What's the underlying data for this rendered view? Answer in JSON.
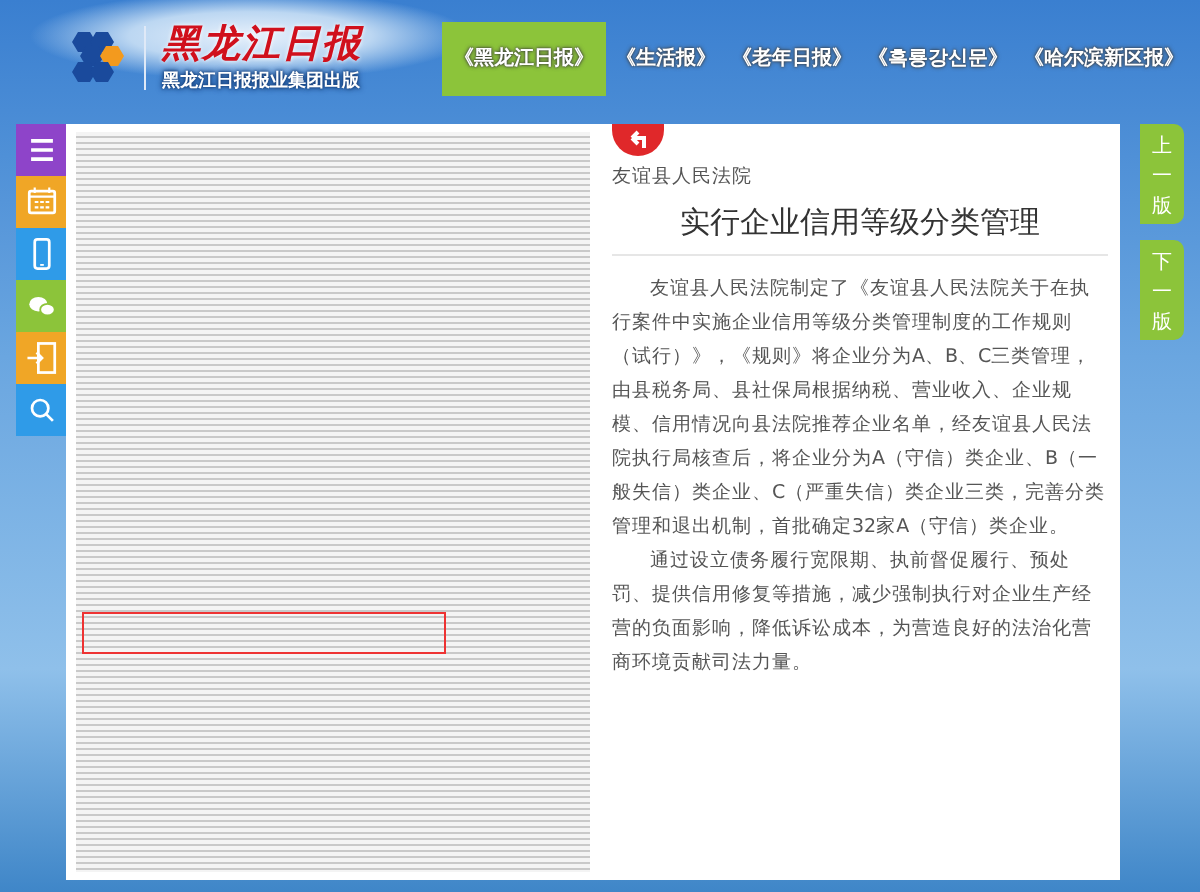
{
  "header": {
    "logo_text": "黑龙江日报",
    "subtitle": "黑龙江日报报业集团出版"
  },
  "papers": [
    {
      "label": "《黑龙江日报》",
      "selected": true
    },
    {
      "label": "《生活报》",
      "selected": false
    },
    {
      "label": "《老年日报》",
      "selected": false
    },
    {
      "label": "《흑룡강신문》",
      "selected": false
    },
    {
      "label": "《哈尔滨新区报》",
      "selected": false
    }
  ],
  "toolbar": [
    {
      "kind": "menu",
      "color": "#8e44c9"
    },
    {
      "kind": "calendar",
      "color": "#f0a626"
    },
    {
      "kind": "phone",
      "color": "#2f9be8"
    },
    {
      "kind": "chat",
      "color": "#8cc43a"
    },
    {
      "kind": "import",
      "color": "#f0a626"
    },
    {
      "kind": "search",
      "color": "#2f9be8"
    }
  ],
  "article": {
    "source": "友谊县人民法院",
    "title": "实行企业信用等级分类管理",
    "paragraphs": [
      "友谊县人民法院制定了《友谊县人民法院关于在执行案件中实施企业信用等级分类管理制度的工作规则（试行）》，《规则》将企业分为A、B、C三类管理，由县税务局、县社保局根据纳税、营业收入、企业规模、信用情况向县法院推荐企业名单，经友谊县人民法院执行局核查后，将企业分为A（守信）类企业、B（一般失信）类企业、C（严重失信）类企业三类，完善分类管理和退出机制，首批确定32家A（守信）类企业。",
      "通过设立债务履行宽限期、执前督促履行、预处罚、提供信用修复等措施，减少强制执行对企业生产经营的负面影响，降低诉讼成本，为营造良好的法治化营商环境贡献司法力量。"
    ]
  },
  "page_nav": [
    {
      "label": "上一版"
    },
    {
      "label": "下一版"
    }
  ]
}
